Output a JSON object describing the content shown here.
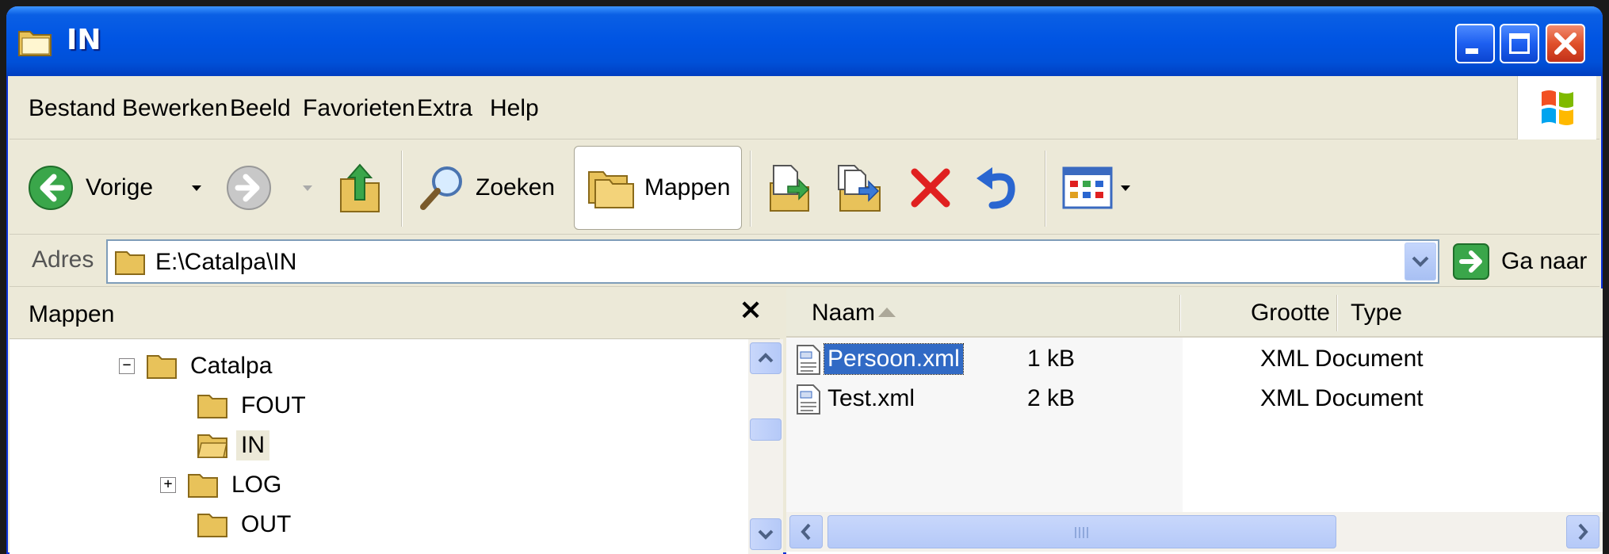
{
  "window": {
    "title": "IN"
  },
  "menu": {
    "items": [
      {
        "label": "Bestand"
      },
      {
        "label": "Bewerken"
      },
      {
        "label": "Beeld"
      },
      {
        "label": "Favorieten"
      },
      {
        "label": "Extra"
      },
      {
        "label": "Help"
      }
    ]
  },
  "toolbar": {
    "back_label": "Vorige",
    "search_label": "Zoeken",
    "folders_label": "Mappen"
  },
  "address": {
    "label": "Adres",
    "path": "E:\\Catalpa\\IN",
    "go_label": "Ga naar"
  },
  "folders_pane": {
    "title": "Mappen",
    "close_glyph": "×",
    "tree": [
      {
        "label": "Catalpa",
        "expander": "−"
      },
      {
        "label": "FOUT"
      },
      {
        "label": "IN"
      },
      {
        "label": "LOG",
        "expander": "+"
      },
      {
        "label": "OUT"
      }
    ]
  },
  "file_list": {
    "columns": {
      "name": "Naam",
      "size": "Grootte",
      "type": "Type"
    },
    "rows": [
      {
        "name": "Persoon.xml",
        "size": "1 kB",
        "type": "XML Document",
        "selected": true
      },
      {
        "name": "Test.xml",
        "size": "2 kB",
        "type": "XML Document",
        "selected": false
      }
    ]
  },
  "colors": {
    "titlebar_blue": "#0054e3",
    "selection_blue": "#316ac5",
    "chrome_beige": "#ece9d8",
    "close_red": "#e0502a"
  }
}
